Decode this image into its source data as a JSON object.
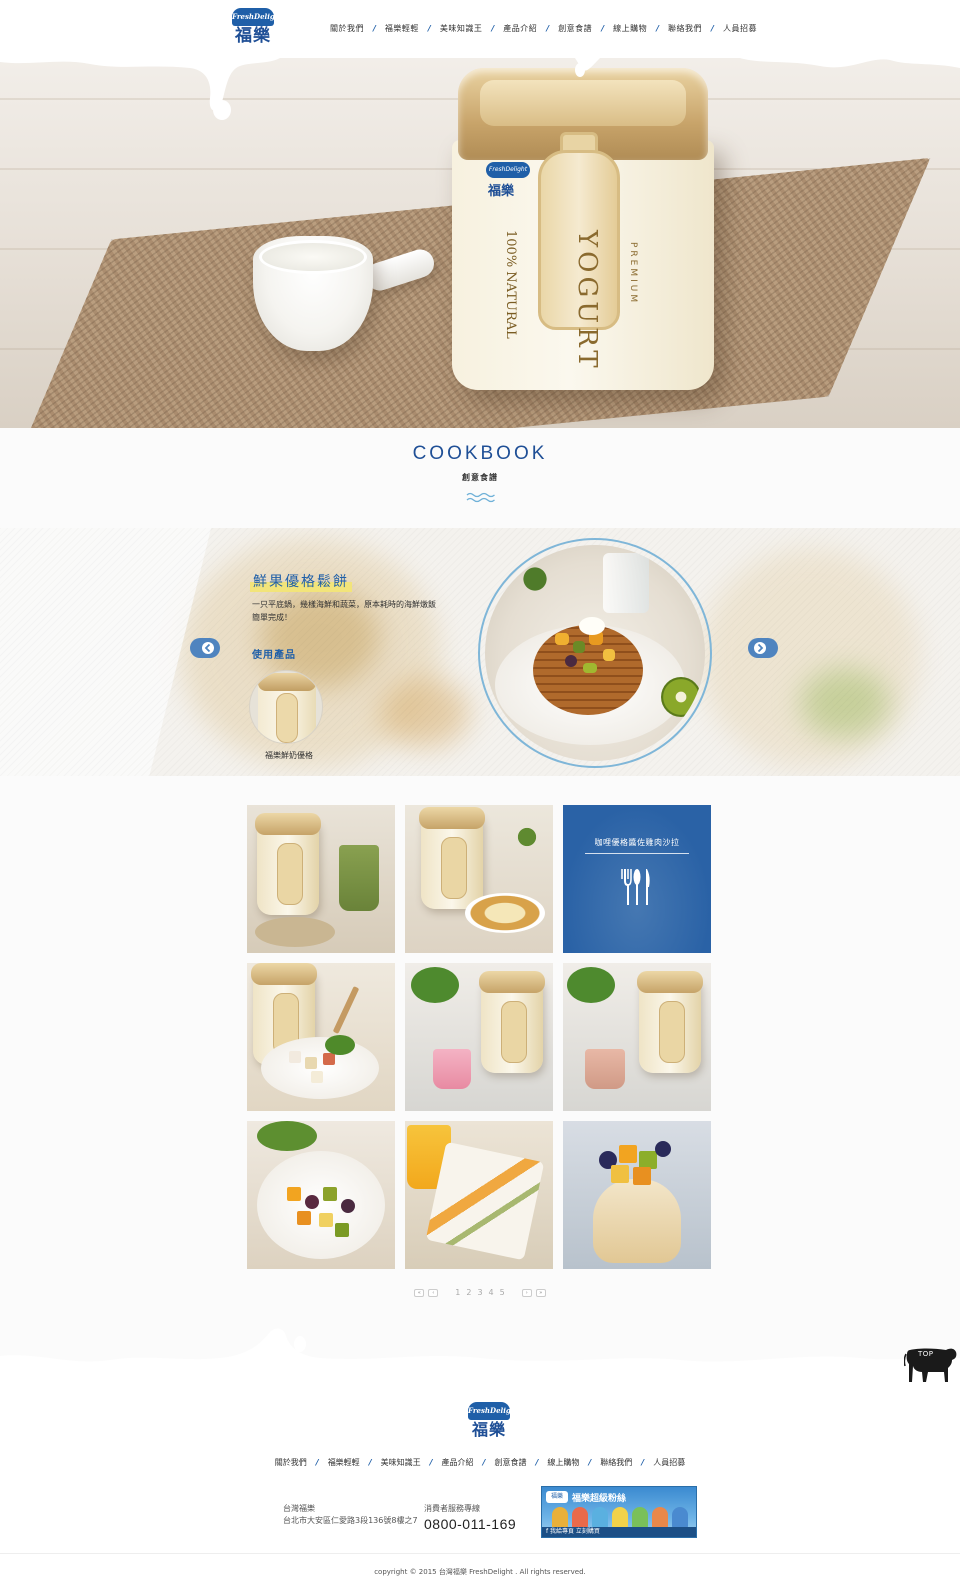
{
  "brand": {
    "badge": "FreshDelight",
    "name_cn": "福樂"
  },
  "nav": {
    "items": [
      "關於我們",
      "福樂輕輕",
      "美味知識王",
      "產品介紹",
      "創意食譜",
      "線上購物",
      "聯絡我們",
      "人員招募"
    ],
    "separator": "/"
  },
  "hero": {
    "tub_brand": "FreshDelight",
    "tub_brand_cn": "福樂",
    "tub_word": "YOGURT",
    "tub_premium": "PREMIUM",
    "tub_natural": "100% NATURAL"
  },
  "cookbook": {
    "title": "COOKBOOK",
    "subtitle": "創意食譜"
  },
  "slider": {
    "recipe_title": "鮮果優格鬆餅",
    "recipe_desc": "一只平底鍋，幾樣海鮮和蔬菜，原本耗時的海鮮燉飯簡單完成！",
    "product_label": "使用產品",
    "product_name": "福樂鮮奶優格",
    "prev_icon": "chevron-left-icon",
    "next_icon": "chevron-right-icon"
  },
  "grid": {
    "featured_title": "咖哩優格醬佐雞肉沙拉",
    "featured_icon": "cutlery-icon"
  },
  "pagination": {
    "first": "«",
    "prev": "‹",
    "pages": [
      "1",
      "2",
      "3",
      "4",
      "5"
    ],
    "next": "›",
    "last": "»"
  },
  "top_button": {
    "label": "TOP",
    "icon": "cow-icon"
  },
  "footer": {
    "nav": [
      "關於我們",
      "福樂輕輕",
      "美味知識王",
      "產品介紹",
      "創意食譜",
      "線上購物",
      "聯絡我們",
      "人員招募"
    ],
    "company": "台灣福樂",
    "address": "台北市大安區仁愛路3段136號8樓之7",
    "hotline_label": "消費者服務專線",
    "hotline": "0800-011-169",
    "fb_title": "福樂超級粉絲",
    "fb_mark": "福樂",
    "fb_bar": "f 我給專頁   立刻購買",
    "copyright": "copyright © 2015 台灣福樂 FreshDelight . All rights reserved."
  },
  "colors": {
    "brand_blue": "#1f5fa8",
    "accent_blue": "#2a62a6",
    "highlight_yellow": "#f2e47a"
  }
}
